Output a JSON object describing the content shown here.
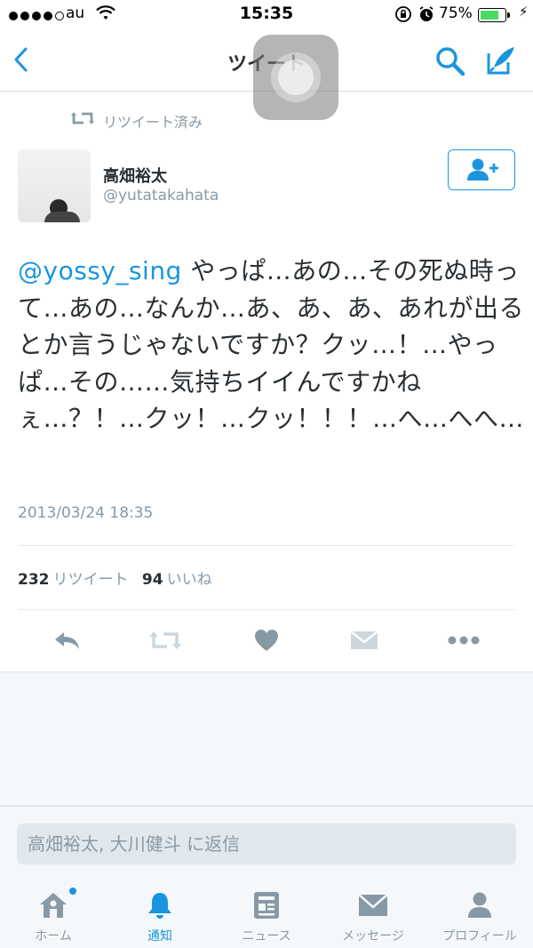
{
  "status_bar": {
    "carrier": "au",
    "time": "15:35",
    "battery_percent": "75%",
    "signal_dots_filled": 4,
    "signal_dots_total": 5,
    "battery_level": 0.75,
    "icons": [
      "signal-dots",
      "wifi-icon",
      "orientation-lock-icon",
      "alarm-icon",
      "battery-icon",
      "charging-icon"
    ]
  },
  "nav": {
    "title": "ツイート",
    "icons": [
      "back-chevron-icon",
      "search-icon",
      "compose-icon"
    ]
  },
  "retweet_context": {
    "label": "リツイート済み",
    "icon": "retweet-icon"
  },
  "author": {
    "name": "高畑裕太",
    "handle": "@yutatakahata",
    "follow_icon": "follow-user-icon"
  },
  "tweet": {
    "mention": "@yossy_sing",
    "text": " やっぱ…あの…その死ぬ時って…あの…なんか…あ、あ、あ、あれが出るとか言うじゃないですか？クッ…！…やっぱ…その……気持ちイイんですかねぇ…？！…クッ！…クッ！！！…へ…へへ…",
    "timestamp": "2013/03/24 18:35"
  },
  "stats": {
    "retweets_count": "232",
    "retweets_label": "リツイート",
    "likes_count": "94",
    "likes_label": "いいね"
  },
  "actions": [
    "reply-icon",
    "retweet-icon",
    "like-icon",
    "direct-message-icon",
    "more-icon"
  ],
  "reply": {
    "placeholder": "高畑裕太, 大川健斗 に返信"
  },
  "tabs": [
    {
      "label": "ホーム",
      "icon": "home-icon",
      "active": false,
      "has_badge": true
    },
    {
      "label": "通知",
      "icon": "bell-icon",
      "active": true,
      "has_badge": false
    },
    {
      "label": "ニュース",
      "icon": "news-icon",
      "active": false,
      "has_badge": false
    },
    {
      "label": "メッセージ",
      "icon": "envelope-icon",
      "active": false,
      "has_badge": false
    },
    {
      "label": "プロフィール",
      "icon": "profile-icon",
      "active": false,
      "has_badge": false
    }
  ],
  "colors": {
    "accent": "#1b95e0",
    "text": "#292f33",
    "muted": "#8899a6",
    "separator": "#e1e8ed",
    "background_grey": "#f5f8fa",
    "battery_green": "#4cd964"
  }
}
